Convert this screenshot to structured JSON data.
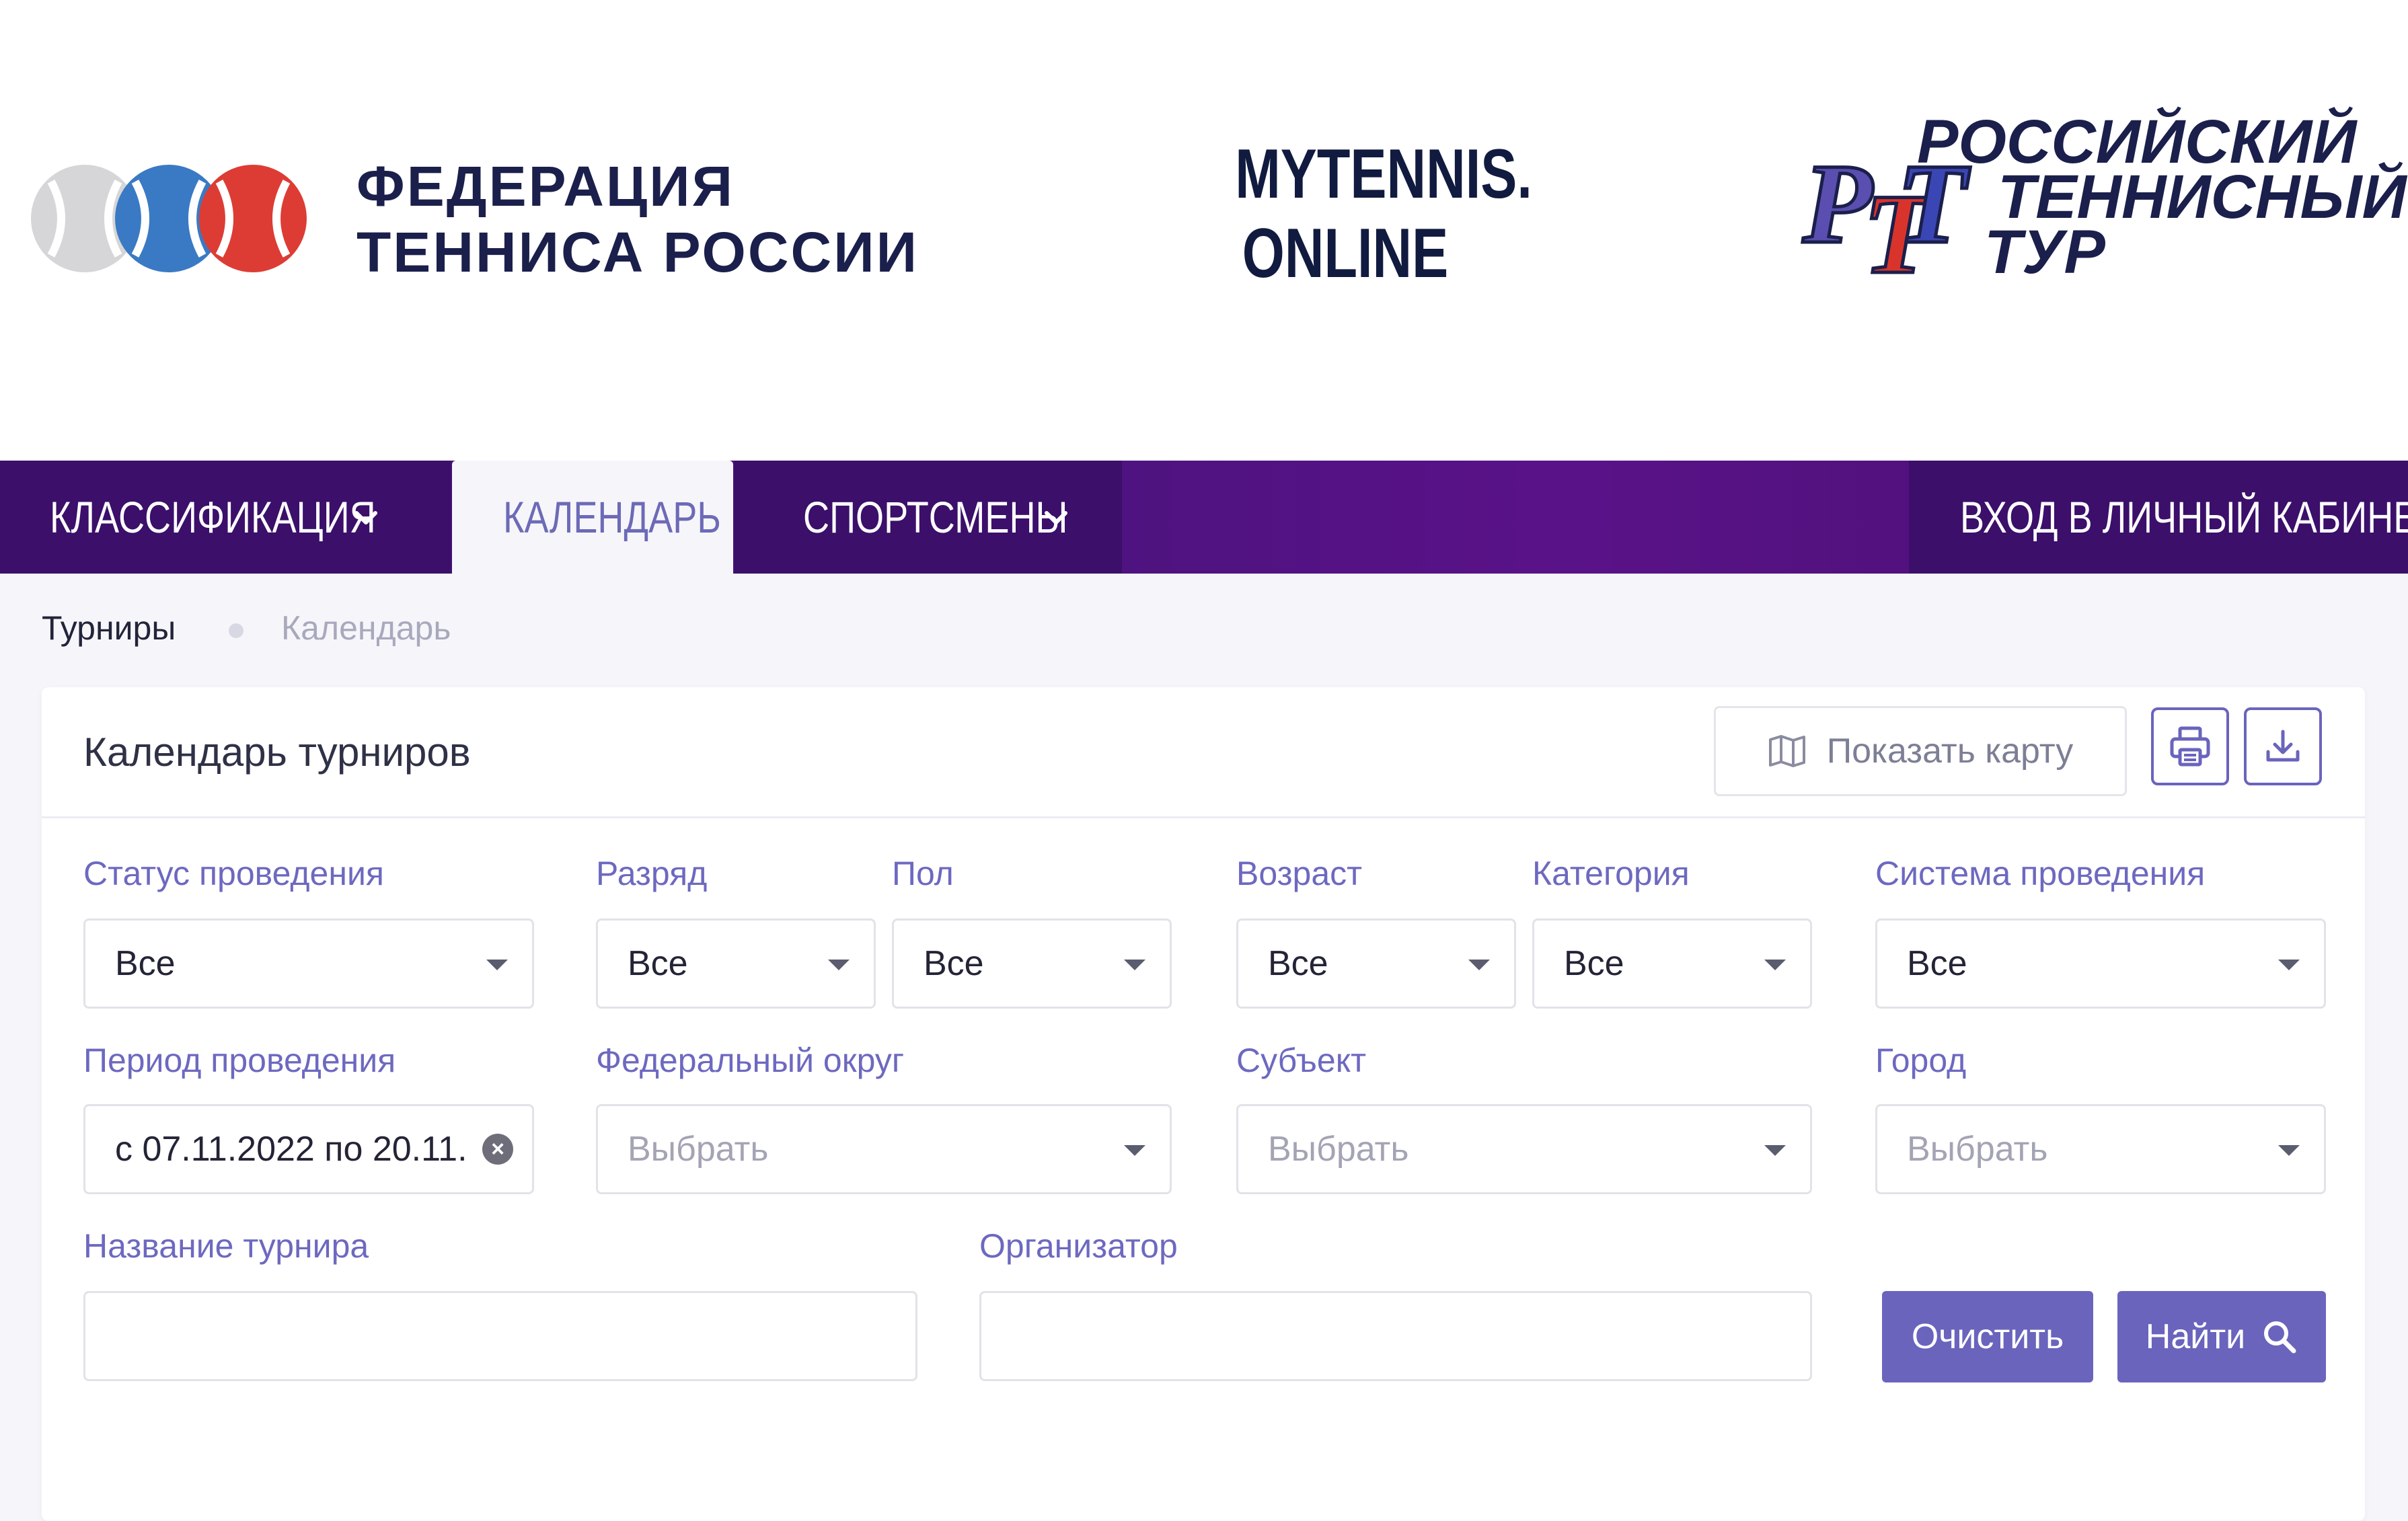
{
  "logos": {
    "ftr_line1": "ФЕДЕРАЦИЯ",
    "ftr_line2": "ТЕННИСА РОССИИ",
    "mytennis_line1": "MYTENNIS.",
    "mytennis_line2": "ONLINE",
    "rtt_line1": "РОССИЙСКИЙ",
    "rtt_line2": "ТЕННИСНЫЙ",
    "rtt_line3": "ТУР",
    "rtt_monogram": "РТТ"
  },
  "nav": {
    "classification": "КЛАССИФИКАЦИЯ",
    "calendar": "КАЛЕНДАРЬ",
    "athletes": "СПОРТСМЕНЫ",
    "login": "ВХОД В ЛИЧНЫЙ КАБИНЕТ"
  },
  "breadcrumb": {
    "root": "Турниры",
    "current": "Календарь"
  },
  "card": {
    "title": "Календарь турниров",
    "map_button": "Показать карту",
    "print_icon": "print-icon",
    "download_icon": "download-icon"
  },
  "filters": {
    "status": {
      "label": "Статус проведения",
      "value": "Все"
    },
    "rank": {
      "label": "Разряд",
      "value": "Все"
    },
    "gender": {
      "label": "Пол",
      "value": "Все"
    },
    "age": {
      "label": "Возраст",
      "value": "Все"
    },
    "category": {
      "label": "Категория",
      "value": "Все"
    },
    "system": {
      "label": "Система проведения",
      "value": "Все"
    },
    "period": {
      "label": "Период проведения",
      "value": "с 07.11.2022 по 20.11."
    },
    "district": {
      "label": "Федеральный округ",
      "placeholder": "Выбрать"
    },
    "subject": {
      "label": "Субъект",
      "placeholder": "Выбрать"
    },
    "city": {
      "label": "Город",
      "placeholder": "Выбрать"
    },
    "tournament_name": {
      "label": "Название турнира",
      "value": ""
    },
    "organizer": {
      "label": "Организатор",
      "value": ""
    }
  },
  "buttons": {
    "clear": "Очистить",
    "find": "Найти"
  },
  "colors": {
    "accent": "#6a64bd",
    "nav": "#4d137f",
    "label": "#6d69c0"
  }
}
